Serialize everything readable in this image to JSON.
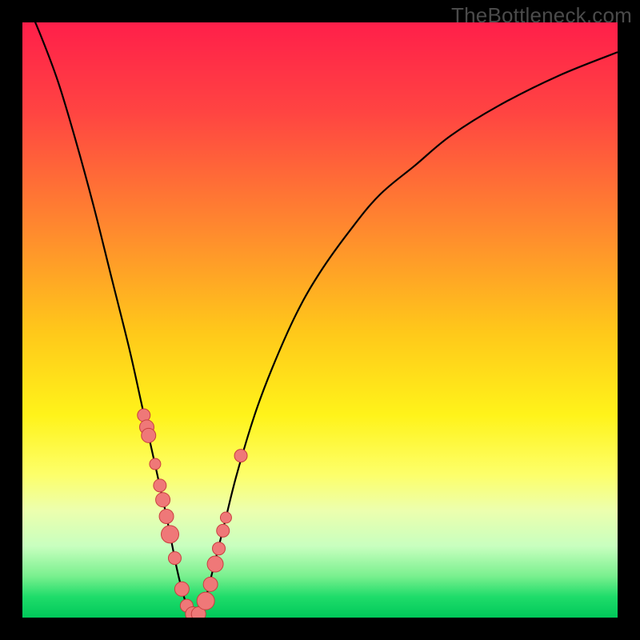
{
  "watermark": "TheBottleneck.com",
  "colors": {
    "frame": "#000000",
    "curve": "#000000",
    "marker_fill": "#ef7878",
    "marker_stroke": "#c93f3f",
    "gradient_stops": [
      {
        "offset": 0.0,
        "color": "#ff1f4a"
      },
      {
        "offset": 0.15,
        "color": "#ff4442"
      },
      {
        "offset": 0.35,
        "color": "#ff8a2e"
      },
      {
        "offset": 0.52,
        "color": "#ffc81a"
      },
      {
        "offset": 0.66,
        "color": "#fff31a"
      },
      {
        "offset": 0.76,
        "color": "#fdff6a"
      },
      {
        "offset": 0.82,
        "color": "#ecffae"
      },
      {
        "offset": 0.88,
        "color": "#c8ffbf"
      },
      {
        "offset": 0.93,
        "color": "#7af08f"
      },
      {
        "offset": 0.965,
        "color": "#1fdc6a"
      },
      {
        "offset": 1.0,
        "color": "#00c95a"
      }
    ]
  },
  "chart_data": {
    "type": "line",
    "title": "",
    "xlabel": "",
    "ylabel": "",
    "xlim": [
      0,
      100
    ],
    "ylim": [
      0,
      100
    ],
    "grid": false,
    "series": [
      {
        "name": "bottleneck-curve",
        "x": [
          0,
          3,
          6,
          9,
          12,
          15,
          18,
          20,
          22,
          24,
          25,
          26,
          27,
          28,
          29,
          30,
          31,
          32,
          34,
          36,
          39,
          42,
          46,
          50,
          55,
          60,
          66,
          72,
          80,
          90,
          100
        ],
        "y": [
          105,
          98,
          90,
          80,
          69,
          57,
          45,
          36,
          27,
          18,
          13,
          8,
          4,
          1,
          0,
          1,
          4,
          8,
          16,
          24,
          34,
          42,
          51,
          58,
          65,
          71,
          76,
          81,
          86,
          91,
          95
        ]
      }
    ],
    "markers": {
      "name": "data-points",
      "x": [
        20.4,
        20.9,
        21.2,
        22.3,
        23.1,
        23.6,
        24.2,
        24.8,
        25.6,
        26.8,
        27.6,
        28.6,
        29.6,
        30.8,
        31.6,
        32.4,
        33.0,
        33.7,
        34.2,
        36.7
      ],
      "y": [
        34.0,
        32.0,
        30.6,
        25.8,
        22.2,
        19.8,
        17.0,
        14.0,
        10.0,
        4.8,
        2.0,
        0.6,
        0.6,
        2.8,
        5.6,
        9.0,
        11.6,
        14.6,
        16.8,
        27.2
      ],
      "r": [
        8,
        9,
        9,
        7,
        8,
        9,
        9,
        11,
        8,
        9,
        8,
        9,
        9,
        11,
        9,
        10,
        8,
        8,
        7,
        8
      ]
    }
  }
}
